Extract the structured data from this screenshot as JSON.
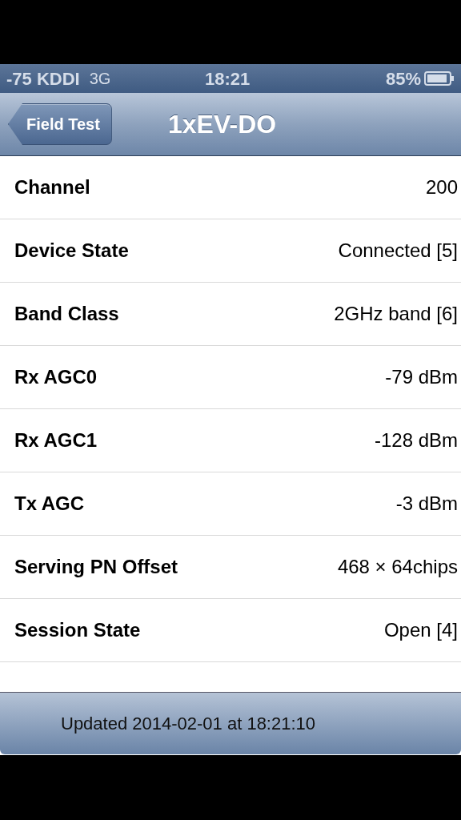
{
  "status_bar": {
    "carrier": "-75 KDDI",
    "network": "3G",
    "time": "18:21",
    "battery": "85%"
  },
  "nav_bar": {
    "back_button": "Field Test",
    "title": "1xEV-DO"
  },
  "rows": [
    {
      "label": "Channel",
      "value": "200"
    },
    {
      "label": "Device State",
      "value": "Connected [5]"
    },
    {
      "label": "Band Class",
      "value": "2GHz band [6]"
    },
    {
      "label": "Rx AGC0",
      "value": "-79 dBm"
    },
    {
      "label": "Rx AGC1",
      "value": "-128 dBm"
    },
    {
      "label": "Tx AGC",
      "value": "-3 dBm"
    },
    {
      "label": "Serving PN Offset",
      "value": "468 × 64chips"
    },
    {
      "label": "Session State",
      "value": "Open [4]"
    }
  ],
  "toolbar": {
    "text": "Updated 2014-02-01 at 18:21:10"
  }
}
